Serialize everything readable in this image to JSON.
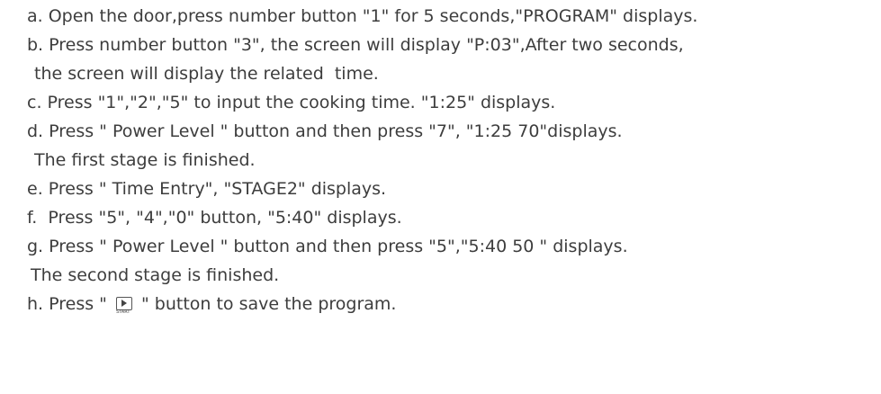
{
  "steps": {
    "a": "a. Open the door,press number button \"1\" for 5 seconds,\"PROGRAM\" displays.",
    "b": "b. Press number button \"3\", the screen will display \"P:03\",After two seconds,",
    "b2": "the screen will display the related  time.",
    "c": "c. Press \"1\",\"2\",\"5\" to input the cooking time. \"1:25\" displays.",
    "d": "d. Press \" Power Level \" button and then press \"7\", \"1:25 70\"displays.",
    "d2": "The first stage is finished.",
    "e": "e. Press \" Time Entry\", \"STAGE2\" displays.",
    "f": "f.  Press \"5\", \"4\",\"0\" button, \"5:40\" displays.",
    "g": "g. Press \" Power Level \" button and then press \"5\",\"5:40 50 \" displays.",
    "g2": "The second stage is finished.",
    "h_prefix": "h. Press \" ",
    "h_suffix": " \" button to save the program."
  },
  "start_icon": {
    "label": "START",
    "icon": "play-triangle-icon"
  }
}
